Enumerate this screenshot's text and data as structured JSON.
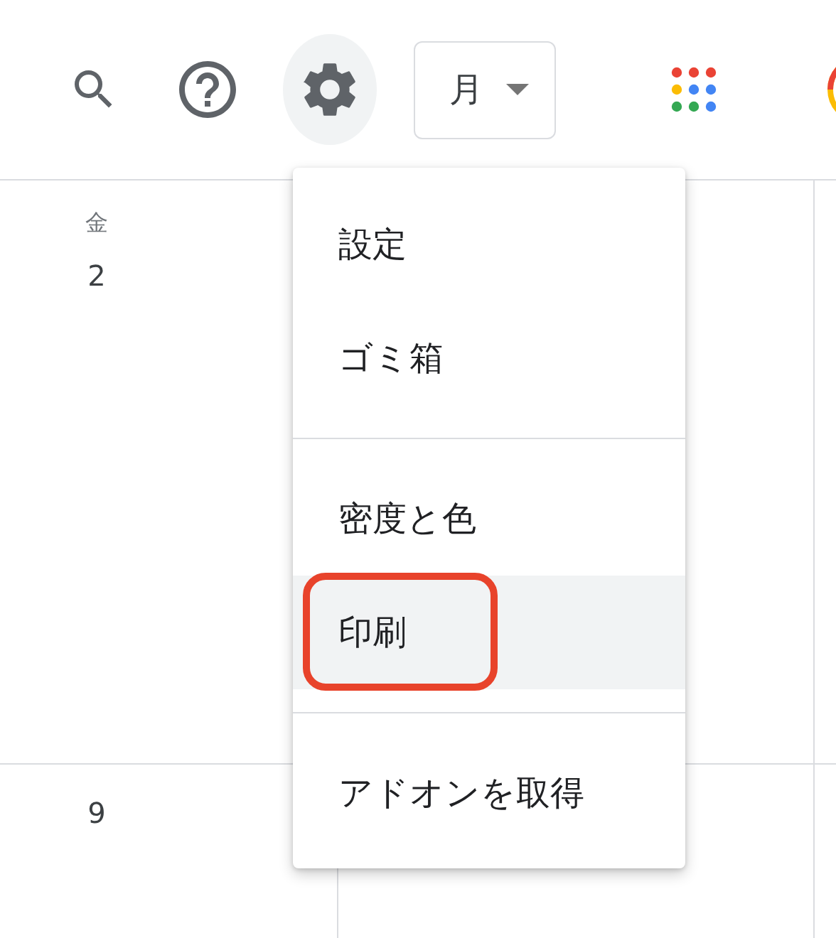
{
  "toolbar": {
    "view_selector": {
      "value": "月"
    }
  },
  "calendar": {
    "days": [
      {
        "weekday": "金",
        "date": "2"
      },
      {
        "date": "9"
      }
    ]
  },
  "settings_menu": {
    "groups": [
      {
        "items": [
          {
            "label": "設定",
            "selected": false,
            "outlined": false
          },
          {
            "label": "ゴミ箱",
            "selected": false,
            "outlined": false
          }
        ]
      },
      {
        "items": [
          {
            "label": "密度と色",
            "selected": false,
            "outlined": false
          },
          {
            "label": "印刷",
            "selected": true,
            "outlined": true
          }
        ]
      },
      {
        "items": [
          {
            "label": "アドオンを取得",
            "selected": false,
            "outlined": false
          }
        ]
      }
    ]
  }
}
